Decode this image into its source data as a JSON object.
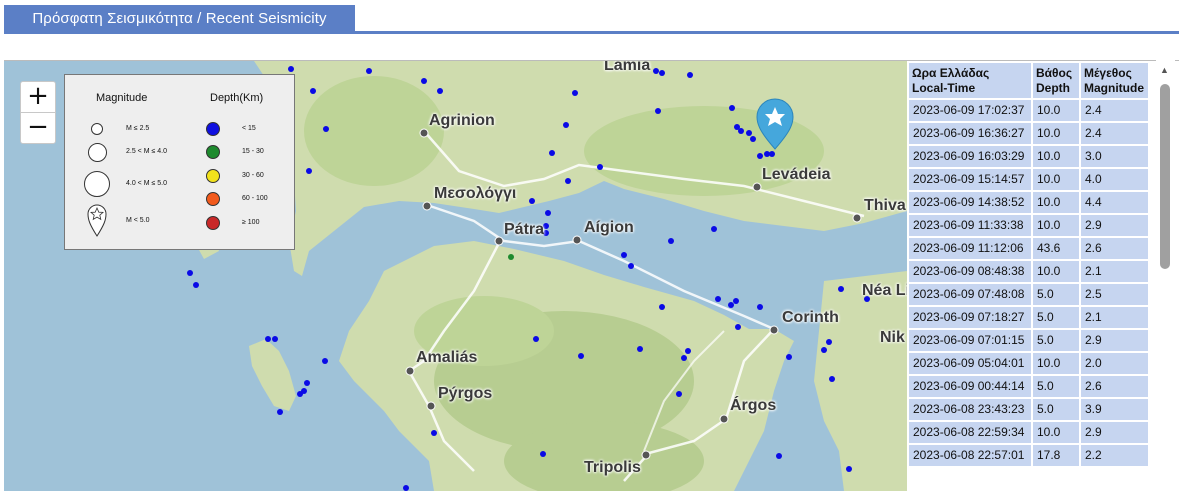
{
  "panel": {
    "title": "Πρόσφατη Σεισμικότητα / Recent Seismicity"
  },
  "map": {
    "zoom_in": "+",
    "zoom_out": "−",
    "cities": [
      "Lamia",
      "Agrinion",
      "Μεσολόγγι",
      "Pátra",
      "Aígion",
      "Levádeia",
      "Thiva",
      "Néa Li",
      "Corinth",
      "Nik",
      "Amaliás",
      "Pýrgos",
      "Árgos",
      "Tripolis"
    ]
  },
  "legend": {
    "magnitude_heading": "Magnitude",
    "depth_heading": "Depth(Km)",
    "magnitude_items": [
      "M ≤ 2.5",
      "2.5 < M ≤ 4.0",
      "4.0 < M ≤ 5.0",
      "M < 5.0"
    ],
    "depth_items": [
      {
        "label": "< 15",
        "color": "#1010e0"
      },
      {
        "label": "15 - 30",
        "color": "#1e8a2e"
      },
      {
        "label": "30 - 60",
        "color": "#f2e21c"
      },
      {
        "label": "60 - 100",
        "color": "#f25a1c"
      },
      {
        "label": "≥ 100",
        "color": "#c82828"
      }
    ]
  },
  "table": {
    "headers": [
      {
        "line1": "Ωρα Ελλάδας",
        "line2": "Local-Time"
      },
      {
        "line1": "Βάθος",
        "line2": "Depth"
      },
      {
        "line1": "Μέγεθος",
        "line2": "Magnitude"
      }
    ],
    "rows": [
      [
        "2023-06-09 17:02:37",
        "10.0",
        "2.4"
      ],
      [
        "2023-06-09 16:36:27",
        "10.0",
        "2.4"
      ],
      [
        "2023-06-09 16:03:29",
        "10.0",
        "3.0"
      ],
      [
        "2023-06-09 15:14:57",
        "10.0",
        "4.0"
      ],
      [
        "2023-06-09 14:38:52",
        "10.0",
        "4.4"
      ],
      [
        "2023-06-09 11:33:38",
        "10.0",
        "2.9"
      ],
      [
        "2023-06-09 11:12:06",
        "43.6",
        "2.6"
      ],
      [
        "2023-06-09 08:48:38",
        "10.0",
        "2.1"
      ],
      [
        "2023-06-09 07:48:08",
        "5.0",
        "2.5"
      ],
      [
        "2023-06-09 07:18:27",
        "5.0",
        "2.1"
      ],
      [
        "2023-06-09 07:01:15",
        "5.0",
        "2.9"
      ],
      [
        "2023-06-09 05:04:01",
        "10.0",
        "2.0"
      ],
      [
        "2023-06-09 00:44:14",
        "5.0",
        "2.6"
      ],
      [
        "2023-06-08 23:43:23",
        "5.0",
        "3.9"
      ],
      [
        "2023-06-08 22:59:34",
        "10.0",
        "2.9"
      ],
      [
        "2023-06-08 22:57:01",
        "17.8",
        "2.2"
      ]
    ]
  }
}
